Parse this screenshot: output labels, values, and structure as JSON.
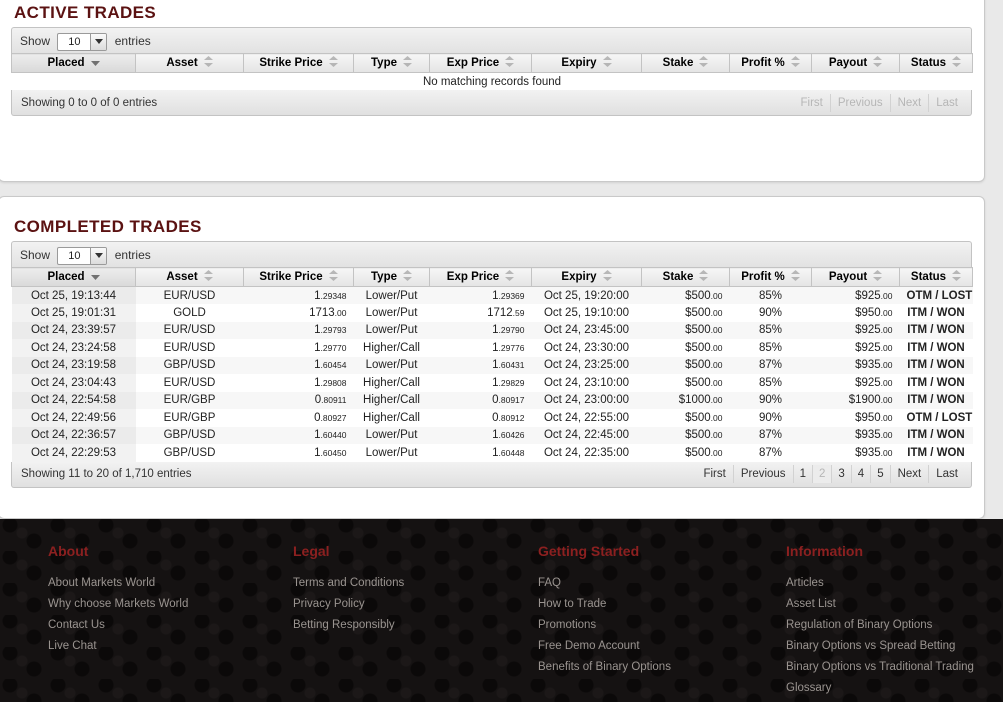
{
  "active": {
    "title": "ACTIVE TRADES",
    "length": {
      "show_label": "Show",
      "value": "10",
      "entries_label": "entries"
    },
    "columns": [
      "Placed",
      "Asset",
      "Strike Price",
      "Type",
      "Exp Price",
      "Expiry",
      "Stake",
      "Profit %",
      "Payout",
      "Status"
    ],
    "empty_text": "No matching records found",
    "info": "Showing 0 to 0 of 0 entries",
    "paginate": {
      "first": "First",
      "previous": "Previous",
      "next": "Next",
      "last": "Last",
      "pages": []
    }
  },
  "completed": {
    "title": "COMPLETED TRADES",
    "length": {
      "show_label": "Show",
      "value": "10",
      "entries_label": "entries"
    },
    "columns": [
      "Placed",
      "Asset",
      "Strike Price",
      "Type",
      "Exp Price",
      "Expiry",
      "Stake",
      "Profit %",
      "Payout",
      "Status"
    ],
    "rows": [
      {
        "placed": "Oct 25, 19:13:44",
        "asset": "EUR/USD",
        "strike_int": "1",
        "strike_frac": ".29348",
        "type": "Lower/Put",
        "exp_int": "1",
        "exp_frac": ".29369",
        "expiry": "Oct 25, 19:20:00",
        "stake_int": "$500",
        "stake_frac": ".00",
        "profit": "85%",
        "payout_int": "$925",
        "payout_frac": ".00",
        "status": "OTM / LOST",
        "status_class": "lost"
      },
      {
        "placed": "Oct 25, 19:01:31",
        "asset": "GOLD",
        "strike_int": "1713",
        "strike_frac": ".00",
        "type": "Lower/Put",
        "exp_int": "1712",
        "exp_frac": ".59",
        "expiry": "Oct 25, 19:10:00",
        "stake_int": "$500",
        "stake_frac": ".00",
        "profit": "90%",
        "payout_int": "$950",
        "payout_frac": ".00",
        "status": "ITM / WON",
        "status_class": "won"
      },
      {
        "placed": "Oct 24, 23:39:57",
        "asset": "EUR/USD",
        "strike_int": "1",
        "strike_frac": ".29793",
        "type": "Lower/Put",
        "exp_int": "1",
        "exp_frac": ".29790",
        "expiry": "Oct 24, 23:45:00",
        "stake_int": "$500",
        "stake_frac": ".00",
        "profit": "85%",
        "payout_int": "$925",
        "payout_frac": ".00",
        "status": "ITM / WON",
        "status_class": "won"
      },
      {
        "placed": "Oct 24, 23:24:58",
        "asset": "EUR/USD",
        "strike_int": "1",
        "strike_frac": ".29770",
        "type": "Higher/Call",
        "exp_int": "1",
        "exp_frac": ".29776",
        "expiry": "Oct 24, 23:30:00",
        "stake_int": "$500",
        "stake_frac": ".00",
        "profit": "85%",
        "payout_int": "$925",
        "payout_frac": ".00",
        "status": "ITM / WON",
        "status_class": "won"
      },
      {
        "placed": "Oct 24, 23:19:58",
        "asset": "GBP/USD",
        "strike_int": "1",
        "strike_frac": ".60454",
        "type": "Lower/Put",
        "exp_int": "1",
        "exp_frac": ".60431",
        "expiry": "Oct 24, 23:25:00",
        "stake_int": "$500",
        "stake_frac": ".00",
        "profit": "87%",
        "payout_int": "$935",
        "payout_frac": ".00",
        "status": "ITM / WON",
        "status_class": "won"
      },
      {
        "placed": "Oct 24, 23:04:43",
        "asset": "EUR/USD",
        "strike_int": "1",
        "strike_frac": ".29808",
        "type": "Higher/Call",
        "exp_int": "1",
        "exp_frac": ".29829",
        "expiry": "Oct 24, 23:10:00",
        "stake_int": "$500",
        "stake_frac": ".00",
        "profit": "85%",
        "payout_int": "$925",
        "payout_frac": ".00",
        "status": "ITM / WON",
        "status_class": "won"
      },
      {
        "placed": "Oct 24, 22:54:58",
        "asset": "EUR/GBP",
        "strike_int": "0",
        "strike_frac": ".80911",
        "type": "Higher/Call",
        "exp_int": "0",
        "exp_frac": ".80917",
        "expiry": "Oct 24, 23:00:00",
        "stake_int": "$1000",
        "stake_frac": ".00",
        "profit": "90%",
        "payout_int": "$1900",
        "payout_frac": ".00",
        "status": "ITM / WON",
        "status_class": "won"
      },
      {
        "placed": "Oct 24, 22:49:56",
        "asset": "EUR/GBP",
        "strike_int": "0",
        "strike_frac": ".80927",
        "type": "Higher/Call",
        "exp_int": "0",
        "exp_frac": ".80912",
        "expiry": "Oct 24, 22:55:00",
        "stake_int": "$500",
        "stake_frac": ".00",
        "profit": "90%",
        "payout_int": "$950",
        "payout_frac": ".00",
        "status": "OTM / LOST",
        "status_class": "lost"
      },
      {
        "placed": "Oct 24, 22:36:57",
        "asset": "GBP/USD",
        "strike_int": "1",
        "strike_frac": ".60440",
        "type": "Lower/Put",
        "exp_int": "1",
        "exp_frac": ".60426",
        "expiry": "Oct 24, 22:45:00",
        "stake_int": "$500",
        "stake_frac": ".00",
        "profit": "87%",
        "payout_int": "$935",
        "payout_frac": ".00",
        "status": "ITM / WON",
        "status_class": "won"
      },
      {
        "placed": "Oct 24, 22:29:53",
        "asset": "GBP/USD",
        "strike_int": "1",
        "strike_frac": ".60450",
        "type": "Lower/Put",
        "exp_int": "1",
        "exp_frac": ".60448",
        "expiry": "Oct 24, 22:35:00",
        "stake_int": "$500",
        "stake_frac": ".00",
        "profit": "87%",
        "payout_int": "$935",
        "payout_frac": ".00",
        "status": "ITM / WON",
        "status_class": "won"
      }
    ],
    "info": "Showing 11 to 20 of 1,710 entries",
    "paginate": {
      "first": "First",
      "previous": "Previous",
      "next": "Next",
      "last": "Last",
      "pages": [
        "1",
        "2",
        "3",
        "4",
        "5"
      ],
      "current": "2"
    }
  },
  "footer": {
    "columns": [
      {
        "heading": "About",
        "links": [
          "About Markets World",
          "Why choose Markets World",
          "Contact Us",
          "Live Chat"
        ]
      },
      {
        "heading": "Legal",
        "links": [
          "Terms and Conditions",
          "Privacy Policy",
          "Betting Responsibly"
        ]
      },
      {
        "heading": "Getting Started",
        "links": [
          "FAQ",
          "How to Trade",
          "Promotions",
          "Free Demo Account",
          "Benefits of Binary Options"
        ]
      },
      {
        "heading": "Information",
        "links": [
          "Articles",
          "Asset List",
          "Regulation of Binary Options",
          "Binary Options vs Spread Betting",
          "Binary Options vs Traditional Trading",
          "Glossary"
        ]
      }
    ]
  },
  "colors": {
    "heading": "#5b1212",
    "footer_heading": "#8c2020",
    "won": "#0a8a0a",
    "lost": "#cc0000",
    "page_bg": "#e9e9e9",
    "footer_bg": "#151212"
  }
}
